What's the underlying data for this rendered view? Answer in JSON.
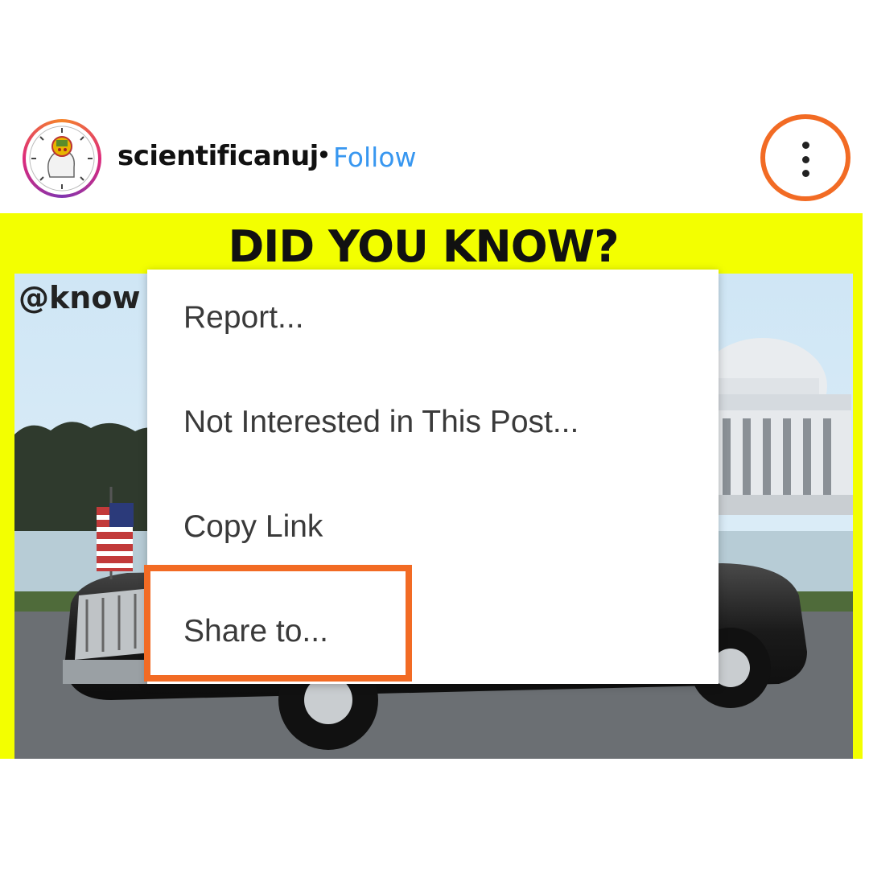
{
  "header": {
    "username": "scientificanuj",
    "separator": "•",
    "follow_label": "Follow",
    "more_icon": "more-vertical-icon"
  },
  "post": {
    "headline": "DID YOU KNOW?",
    "watermark": "@know"
  },
  "menu": {
    "items": [
      {
        "label": "Report..."
      },
      {
        "label": "Not Interested in This Post..."
      },
      {
        "label": "Copy Link"
      },
      {
        "label": "Share to..."
      }
    ]
  },
  "colors": {
    "accent_highlight": "#f26b24",
    "follow_blue": "#3897f0",
    "post_background": "#f3ff00"
  }
}
